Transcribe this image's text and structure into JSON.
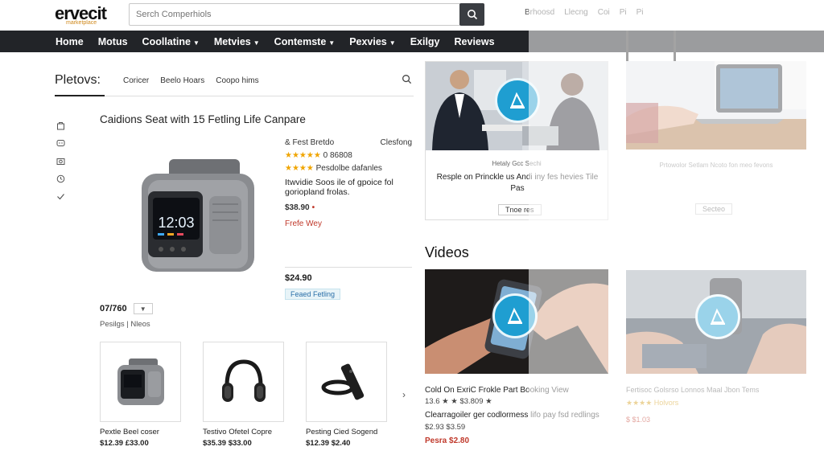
{
  "logo": {
    "text": "ervecit",
    "sub": "marketplace"
  },
  "search": {
    "placeholder": "Serch Comperhiols"
  },
  "top_right": [
    "Brhoosd",
    "Llecng",
    "Coi",
    "Pi",
    "Pi"
  ],
  "nav": [
    {
      "label": "Home",
      "caret": false
    },
    {
      "label": "Motus",
      "caret": false
    },
    {
      "label": "Coollatine",
      "caret": true
    },
    {
      "label": "Metvies",
      "caret": true
    },
    {
      "label": "Contemste",
      "caret": true
    },
    {
      "label": "Pexvies",
      "caret": true
    },
    {
      "label": "Exilgy",
      "caret": false
    },
    {
      "label": "Reviews",
      "caret": false
    }
  ],
  "subnav": {
    "title": "Pletovs:",
    "links": [
      "Coricer",
      "Beelo Hoars",
      "Coopo hims"
    ]
  },
  "product": {
    "title": "Caidions Seat with 15 Fetling Life Canpare",
    "screen_text": "12:03",
    "brand": "& Fest Bretdo",
    "brand_right": "Clesfong",
    "rating_label": "0 86808",
    "rating2_label": "Pesdolbe dafanles",
    "description": "Itwvidie Soos ile of gpoice fol goriopland frolas.",
    "price": "$38.90",
    "red_text": "Frefe Wey",
    "price2": "$24.90",
    "badge": "Feaed Fetling",
    "qty": "07/760",
    "qty_sub": "Pesilgs | Nleos"
  },
  "thumbs": [
    {
      "label": "Pextle Beel coser",
      "price": "$12.39 £33.00"
    },
    {
      "label": "Testivo Ofetel Copre",
      "price": "$35.39 $33.00"
    },
    {
      "label": "Pesting Cied Sogend",
      "price": "$12.39 $2.40"
    }
  ],
  "card1": {
    "caption1": "Hetaly Gcc Sechi",
    "caption2": "Resple on Princkle us Andi iny fes hevies Tile Pas",
    "button": "Tnoe res"
  },
  "card2": {
    "caption": "Prtowolor Setlam Ncoto fon meo fevons",
    "button": "Secteo"
  },
  "videos": {
    "title": "Videos",
    "v1_title": "Cold On ExriC Frokle Part Booking View",
    "v1_rating": "13.6 ★ ★ $3.809 ★",
    "v1_desc": "Clearragoiler ger codlormess lifo pay fsd redlings",
    "v1_price": "$2.93 $3.59",
    "v1_red": "Pesra $2.80",
    "v2_title": "Fertisoc Golsrso Lonnos Maal Jbon Tems",
    "v2_rating": "★★★★ Holvors",
    "v2_red": "$ $1.03"
  }
}
